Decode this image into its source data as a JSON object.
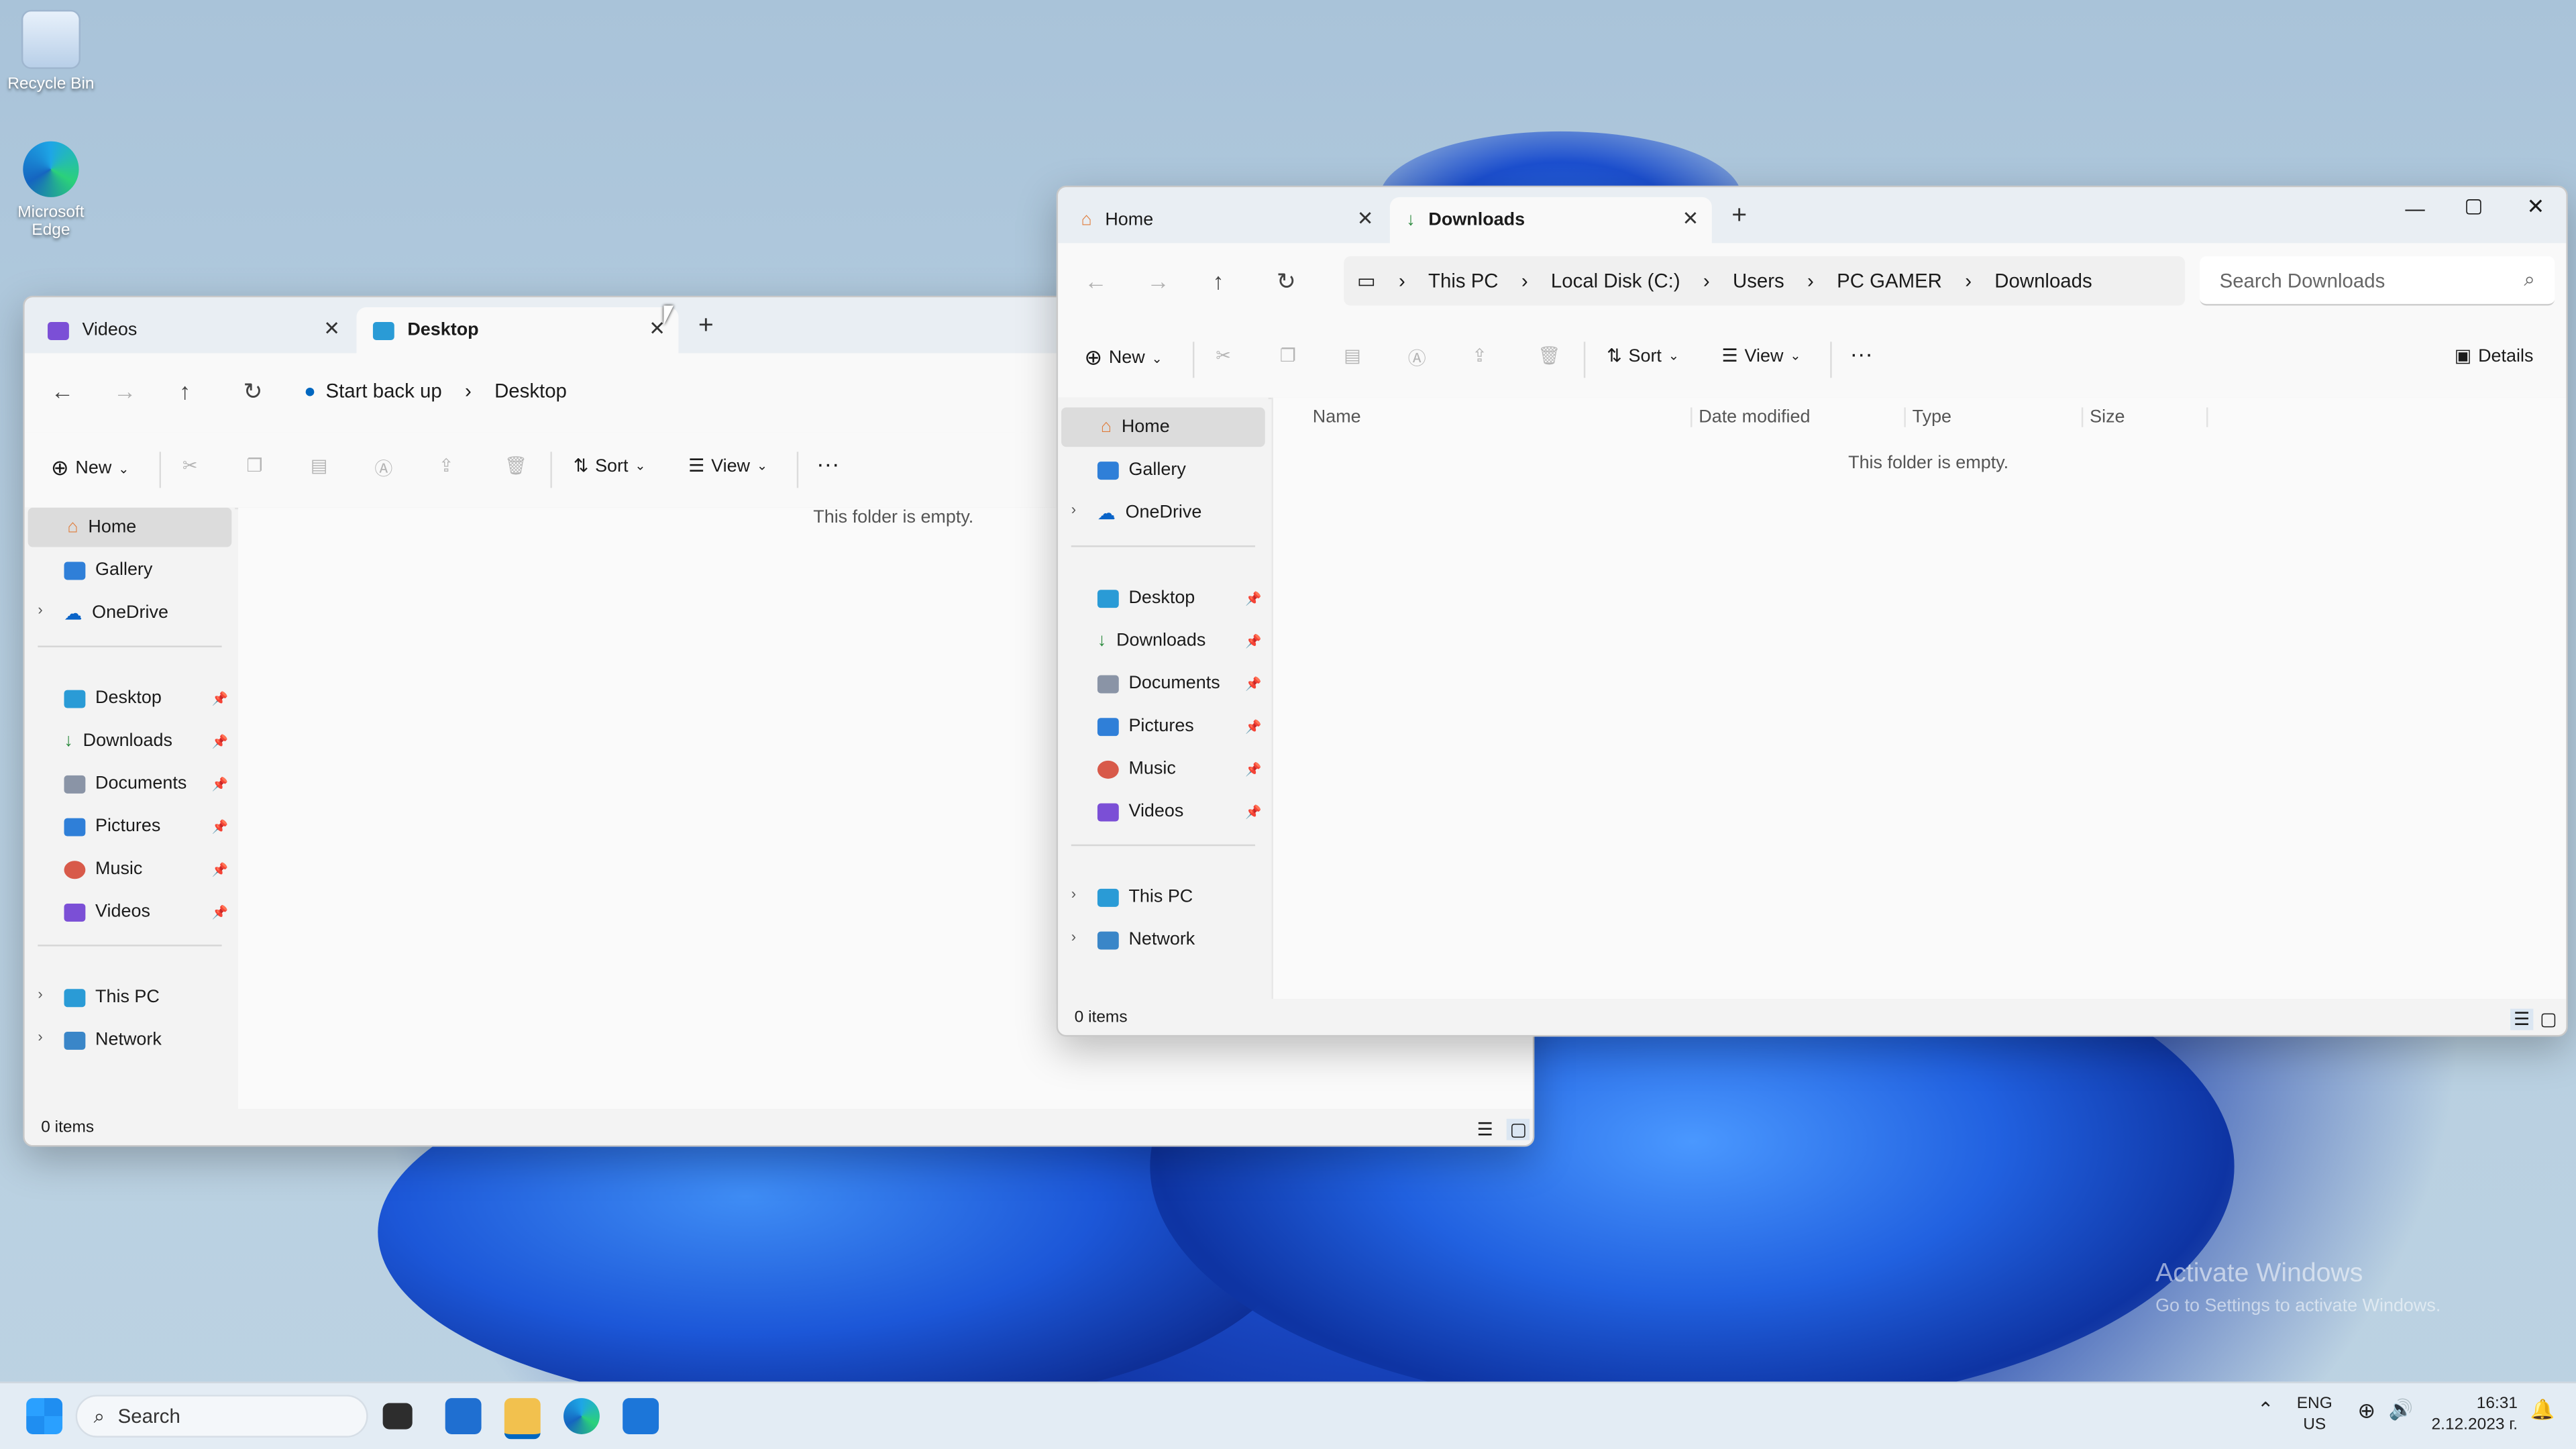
{
  "desktop": {
    "recycle_bin": "Recycle Bin",
    "edge": "Microsoft Edge",
    "watermark_title": "Activate Windows",
    "watermark_sub": "Go to Settings to activate Windows."
  },
  "left_window": {
    "tabs": [
      {
        "label": "Videos"
      },
      {
        "label": "Desktop"
      }
    ],
    "breadcrumb": [
      "Start back up",
      "Desktop"
    ],
    "toolbar": {
      "new": "New",
      "sort": "Sort",
      "view": "View"
    },
    "empty_text": "This folder is empty.",
    "status": "0 items"
  },
  "right_window": {
    "tabs": [
      {
        "label": "Home"
      },
      {
        "label": "Downloads"
      }
    ],
    "breadcrumb": [
      "This PC",
      "Local Disk (C:)",
      "Users",
      "PC GAMER",
      "Downloads"
    ],
    "search_placeholder": "Search Downloads",
    "toolbar": {
      "new": "New",
      "sort": "Sort",
      "view": "View",
      "details": "Details"
    },
    "columns": [
      "Name",
      "Date modified",
      "Type",
      "Size"
    ],
    "empty_text": "This folder is empty.",
    "status": "0 items"
  },
  "sidebar": {
    "top": [
      "Home",
      "Gallery",
      "OneDrive"
    ],
    "pinned": [
      "Desktop",
      "Downloads",
      "Documents",
      "Pictures",
      "Music",
      "Videos"
    ],
    "bottom": [
      "This PC",
      "Network"
    ]
  },
  "taskbar": {
    "search": "Search",
    "lang_top": "ENG",
    "lang_bottom": "US",
    "time": "16:31",
    "date": "2.12.2023 г."
  },
  "colors": {
    "accent": "#0067c0",
    "folder": "#f2c14e"
  }
}
